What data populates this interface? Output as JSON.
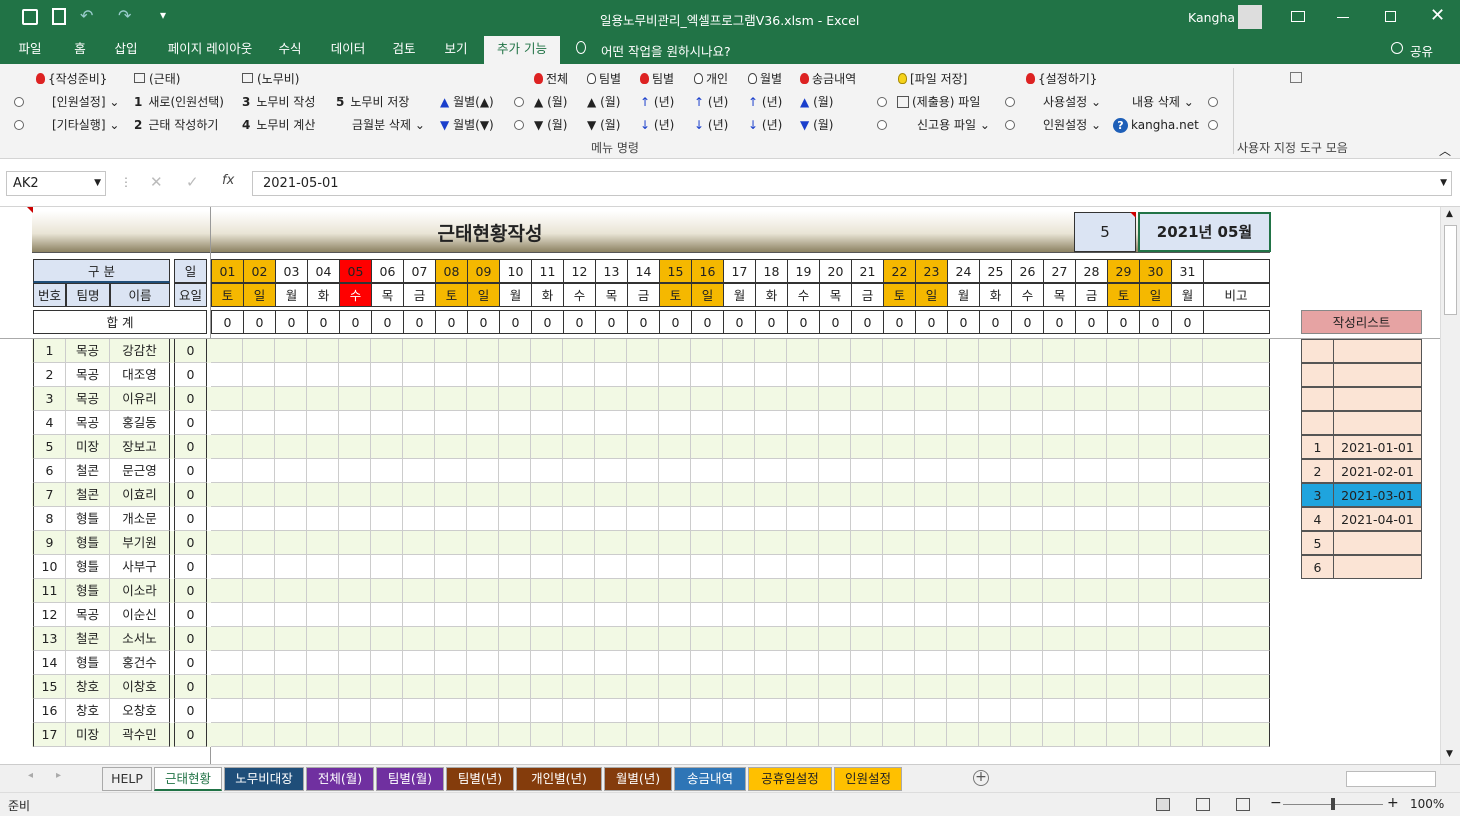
{
  "window": {
    "title": "일용노무비관리_엑셀프로그램V36.xlsm  -  Excel",
    "user": "Kangha"
  },
  "ribbon_tabs": [
    "파일",
    "홈",
    "삽입",
    "페이지 레이아웃",
    "수식",
    "데이터",
    "검토",
    "보기",
    "추가 기능"
  ],
  "tell_me": "어떤 작업을 원하시나요?",
  "share": "공유",
  "ribbon": {
    "g1": {
      "h1": "{작성준비}",
      "a": "[인원설정]",
      "b": "[기타실행]"
    },
    "g2": {
      "h1": "(근태)",
      "a": "새로(인원선택)",
      "b": "근태 작성하기",
      "n1": "1",
      "n2": "2"
    },
    "g3": {
      "h1": "(노무비)",
      "a": "노무비 작성",
      "b": "노무비 계산",
      "a2": "노무비 저장",
      "b2": "금월분 삭제",
      "n1": "3",
      "n2": "4",
      "n3": "5"
    },
    "g4": {
      "a": "월별(▲)",
      "b": "월별(▼)"
    },
    "g5": {
      "h1": "전체",
      "h2": "팀별",
      "h3": "팀별",
      "h4": "개인",
      "h5": "월별",
      "h6": "송금내역",
      "u": "(월)",
      "d": "(월)",
      "u2": "(월)",
      "d2": "(월)",
      "u3": "(년)",
      "d3": "(년)",
      "u4": "(년)",
      "d4": "(년)",
      "u5": "(년)",
      "d5": "(년)",
      "u6": "(월)",
      "d6": "(월)"
    },
    "g6": {
      "h1": "[파일 저장]",
      "a": "(제출용) 파일",
      "b": "신고용 파일"
    },
    "g7": {
      "h1": "{설정하기}",
      "a": "사용설정",
      "b": "인원설정",
      "c": "내용 삭제",
      "d": "kangha.net"
    },
    "group_label": "메뉴 명령",
    "custom_label": "사용자 지정 도구 모음"
  },
  "formula": {
    "namebox": "AK2",
    "value": "2021-05-01"
  },
  "sheet": {
    "title": "근태현황작성",
    "month_num": "5",
    "month_label": "2021년 05월",
    "h_gubun": "구   분",
    "h_il": "일",
    "h_no": "번호",
    "h_team": "팀명",
    "h_name": "이름",
    "h_yoil": "요일",
    "h_total": "합   계",
    "h_note": "비고",
    "days": [
      "01",
      "02",
      "03",
      "04",
      "05",
      "06",
      "07",
      "08",
      "09",
      "10",
      "11",
      "12",
      "13",
      "14",
      "15",
      "16",
      "17",
      "18",
      "19",
      "20",
      "21",
      "22",
      "23",
      "24",
      "25",
      "26",
      "27",
      "28",
      "29",
      "30",
      "31"
    ],
    "weekdays": [
      "토",
      "일",
      "월",
      "화",
      "수",
      "목",
      "금",
      "토",
      "일",
      "월",
      "화",
      "수",
      "목",
      "금",
      "토",
      "일",
      "월",
      "화",
      "수",
      "목",
      "금",
      "토",
      "일",
      "월",
      "화",
      "수",
      "목",
      "금",
      "토",
      "일",
      "월"
    ],
    "day_colors": [
      "#f5b800",
      "#f5b800",
      "",
      "",
      "#ff0000",
      "",
      "",
      "#f5b800",
      "#f5b800",
      "",
      "",
      "",
      "",
      "",
      "#f5b800",
      "#f5b800",
      "",
      "",
      "",
      "",
      "",
      "#f5b800",
      "#f5b800",
      "",
      "",
      "",
      "",
      "",
      "#f5b800",
      "#f5b800",
      ""
    ],
    "total_values": [
      "0",
      "0",
      "0",
      "0",
      "0",
      "0",
      "0",
      "0",
      "0",
      "0",
      "0",
      "0",
      "0",
      "0",
      "0",
      "0",
      "0",
      "0",
      "0",
      "0",
      "0",
      "0",
      "0",
      "0",
      "0",
      "0",
      "0",
      "0",
      "0",
      "0",
      "0"
    ],
    "rows": [
      {
        "no": "1",
        "team": "목공",
        "name": "강감찬",
        "sum": "0"
      },
      {
        "no": "2",
        "team": "목공",
        "name": "대조영",
        "sum": "0"
      },
      {
        "no": "3",
        "team": "목공",
        "name": "이유리",
        "sum": "0"
      },
      {
        "no": "4",
        "team": "목공",
        "name": "홍길동",
        "sum": "0"
      },
      {
        "no": "5",
        "team": "미장",
        "name": "장보고",
        "sum": "0"
      },
      {
        "no": "6",
        "team": "철콘",
        "name": "문근영",
        "sum": "0"
      },
      {
        "no": "7",
        "team": "철콘",
        "name": "이효리",
        "sum": "0"
      },
      {
        "no": "8",
        "team": "형틀",
        "name": "개소문",
        "sum": "0"
      },
      {
        "no": "9",
        "team": "형틀",
        "name": "부기원",
        "sum": "0"
      },
      {
        "no": "10",
        "team": "형틀",
        "name": "사부구",
        "sum": "0"
      },
      {
        "no": "11",
        "team": "형틀",
        "name": "이소라",
        "sum": "0"
      },
      {
        "no": "12",
        "team": "목공",
        "name": "이순신",
        "sum": "0"
      },
      {
        "no": "13",
        "team": "철콘",
        "name": "소서노",
        "sum": "0"
      },
      {
        "no": "14",
        "team": "형틀",
        "name": "홍건수",
        "sum": "0"
      },
      {
        "no": "15",
        "team": "창호",
        "name": "이창호",
        "sum": "0"
      },
      {
        "no": "16",
        "team": "창호",
        "name": "오창호",
        "sum": "0"
      },
      {
        "no": "17",
        "team": "미장",
        "name": "곽수민",
        "sum": "0"
      }
    ],
    "list_title": "작성리스트",
    "list": [
      {
        "n": "",
        "d": ""
      },
      {
        "n": "",
        "d": ""
      },
      {
        "n": "",
        "d": ""
      },
      {
        "n": "",
        "d": ""
      },
      {
        "n": "1",
        "d": "2021-01-01"
      },
      {
        "n": "2",
        "d": "2021-02-01"
      },
      {
        "n": "3",
        "d": "2021-03-01"
      },
      {
        "n": "4",
        "d": "2021-04-01"
      },
      {
        "n": "5",
        "d": ""
      },
      {
        "n": "6",
        "d": ""
      }
    ]
  },
  "sheet_tabs": [
    {
      "label": "HELP",
      "color": "#f0f0f0",
      "fg": "#333"
    },
    {
      "label": "근태현황",
      "color": "#ffffff",
      "fg": "#217346"
    },
    {
      "label": "노무비대장",
      "color": "#1f4e79",
      "fg": "#fff"
    },
    {
      "label": "전체(월)",
      "color": "#7030a0",
      "fg": "#fff"
    },
    {
      "label": "팀별(월)",
      "color": "#7030a0",
      "fg": "#fff"
    },
    {
      "label": "팀별(년)",
      "color": "#843c0c",
      "fg": "#fff"
    },
    {
      "label": "개인별(년)",
      "color": "#843c0c",
      "fg": "#fff"
    },
    {
      "label": "월별(년)",
      "color": "#843c0c",
      "fg": "#fff"
    },
    {
      "label": "송금내역",
      "color": "#2e75b6",
      "fg": "#fff"
    },
    {
      "label": "공휴일설정",
      "color": "#ffc000",
      "fg": "#222"
    },
    {
      "label": "인원설정",
      "color": "#ffc000",
      "fg": "#222"
    }
  ],
  "status": {
    "ready": "준비",
    "zoom": "100%"
  }
}
